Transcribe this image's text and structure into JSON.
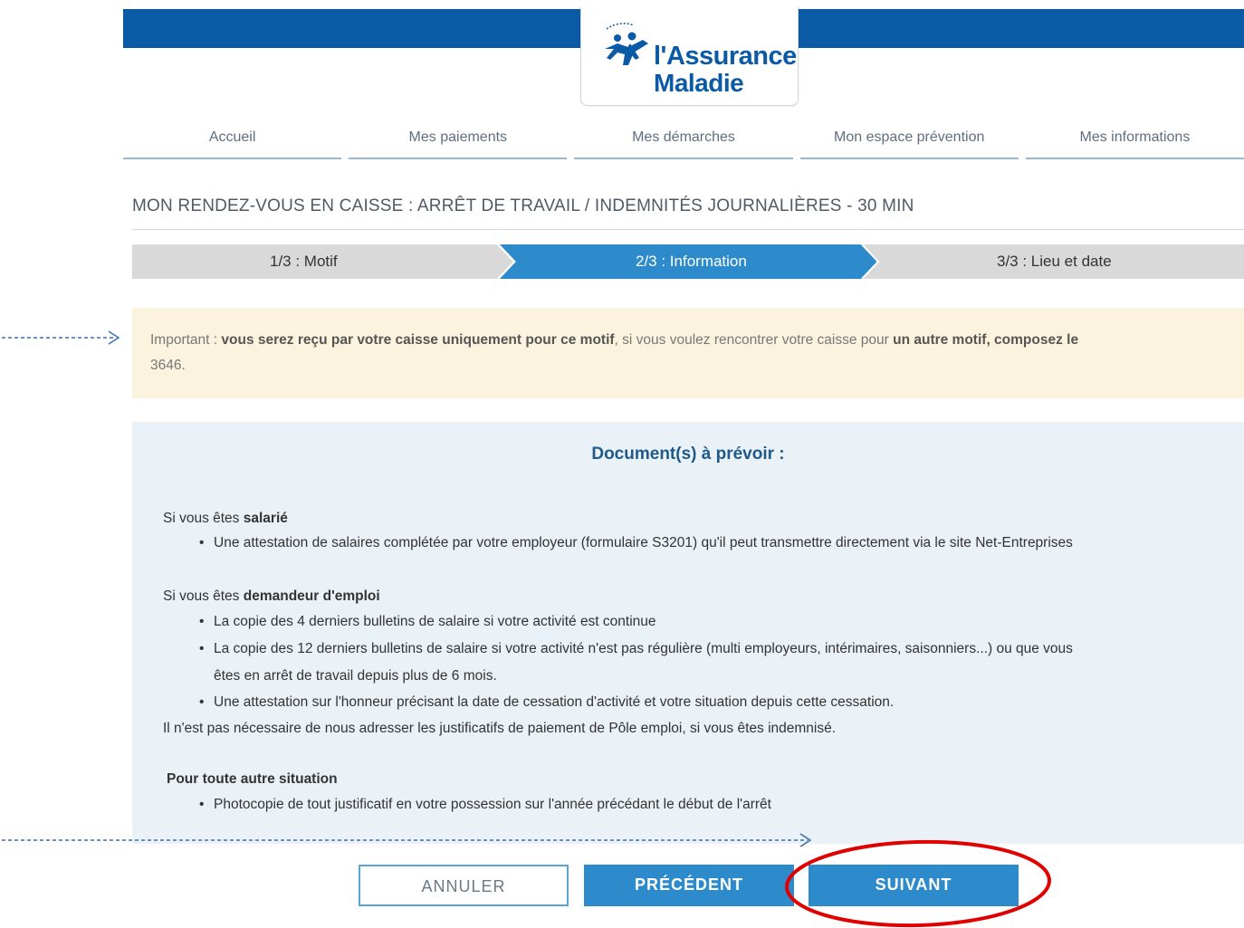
{
  "header": {
    "logo_line1": "l'Assurance",
    "logo_line2": "Maladie",
    "brand_color": "#0b5aa6"
  },
  "nav": {
    "items": [
      {
        "label": "Accueil"
      },
      {
        "label": "Mes paiements"
      },
      {
        "label": "Mes démarches"
      },
      {
        "label": "Mon espace prévention"
      },
      {
        "label": "Mes informations"
      }
    ]
  },
  "page": {
    "title": "MON RENDEZ-VOUS EN CAISSE : ARRÊT DE TRAVAIL / INDEMNITÉS JOURNALIÈRES - 30 MIN"
  },
  "stepper": {
    "steps": [
      {
        "label": "1/3 : Motif",
        "state": "done"
      },
      {
        "label": "2/3 : Information",
        "state": "active"
      },
      {
        "label": "3/3 : Lieu et date",
        "state": "todo"
      }
    ],
    "active_color": "#2e8bcb",
    "inactive_color": "#d9d9d9"
  },
  "alert": {
    "prefix": "Important : ",
    "bold1": "vous serez reçu par votre caisse uniquement pour ce motif",
    "middle": ", si vous voulez rencontrer votre caisse pour ",
    "bold2": "un autre motif, composez le",
    "suffix": "3646."
  },
  "documents": {
    "title": "Document(s) à prévoir :",
    "salarie": {
      "intro": "Si vous êtes ",
      "bold": "salarié",
      "items": [
        "Une attestation de salaires complétée par votre employeur (formulaire S3201) qu'il peut transmettre directement via le site Net-Entreprises"
      ]
    },
    "demandeur": {
      "intro": "Si vous êtes ",
      "bold": "demandeur d'emploi",
      "items": [
        "La copie des 4 derniers bulletins de salaire si votre activité est continue",
        "La copie des 12 derniers bulletins de salaire si votre activité n'est pas régulière (multi employeurs, intérimaires, saisonniers...) ou que vous",
        "êtes en arrêt de travail depuis plus de 6 mois.",
        "Une attestation sur l'honneur précisant la date de cessation d'activité et votre situation depuis cette cessation."
      ],
      "note": "Il n'est pas nécessaire de nous adresser les justificatifs de paiement de Pôle emploi, si vous êtes indemnisé."
    },
    "autre": {
      "bold": "Pour toute autre situation",
      "items": [
        "Photocopie de tout justificatif en votre possession sur l'année précédant le début de l'arrêt"
      ]
    }
  },
  "buttons": {
    "cancel": "ANNULER",
    "previous": "PRÉCÉDENT",
    "next": "SUIVANT"
  },
  "annotations": {
    "arrow_color": "#3a6fb0",
    "circle_color": "#e00000"
  }
}
